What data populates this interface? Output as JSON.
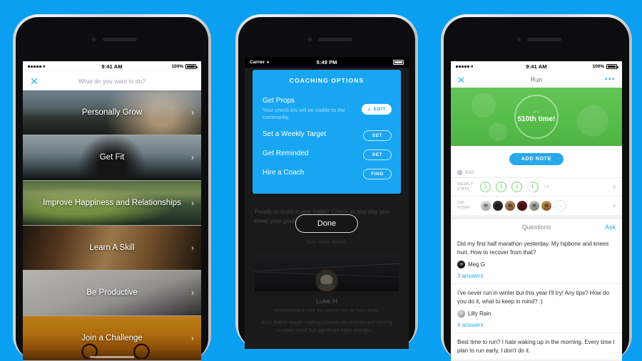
{
  "background_color": "#0a9ff0",
  "phone1": {
    "status_bar": {
      "signal": "•••••",
      "wifi_icon": "wifi-icon",
      "time": "9:41 AM",
      "battery_pct": "100%"
    },
    "search": {
      "close_icon": "✕",
      "placeholder": "What do you want to do?"
    },
    "categories": [
      {
        "label": "Personally Grow",
        "chevron": "›"
      },
      {
        "label": "Get Fit",
        "chevron": "›"
      },
      {
        "label": "Improve Happiness and Relationships",
        "chevron": "›"
      },
      {
        "label": "Learn A Skill",
        "chevron": "›"
      },
      {
        "label": "Be Productive",
        "chevron": "›"
      },
      {
        "label": "Join a Challenge",
        "chevron": "›"
      }
    ]
  },
  "phone2": {
    "status_bar": {
      "carrier": "Carrier",
      "wifi_icon": "wifi-icon",
      "time": "5:49 PM"
    },
    "modal": {
      "title": "COACHING OPTIONS",
      "accent_color": "#18a6f2",
      "options": [
        {
          "title": "Get Props",
          "subtitle": "Your check-ins will be visible to the community.",
          "action": "EDIT",
          "action_style": "filled",
          "check": "✓"
        },
        {
          "title": "Set a Weekly Target",
          "subtitle": "",
          "action": "SET",
          "action_style": "outline",
          "check": ""
        },
        {
          "title": "Get Reminded",
          "subtitle": "",
          "action": "SET",
          "action_style": "outline",
          "check": ""
        },
        {
          "title": "Hire a Coach",
          "subtitle": "",
          "action": "FIND",
          "action_style": "outline",
          "check": ""
        }
      ]
    },
    "done_label": "Done",
    "background": {
      "body_text": "Ready to build a new habit? Check in any day you meet your goal.",
      "link_text": "See more details",
      "coach_name": "Luke H",
      "coach_role": "RESPONSIBLE FOR 63 CHECK-INS IN THIS GOAL",
      "coach_desc": "Buzz British lawyer making positive life choices and striving to make small but significant habit changes…"
    }
  },
  "phone3": {
    "status_bar": {
      "signal": "•••••",
      "wifi_icon": "wifi-icon",
      "time": "9:41 AM",
      "battery_pct": "100%"
    },
    "nav": {
      "close_icon": "✕",
      "title": "Run",
      "more_icon": "•••"
    },
    "hero": {
      "sub_label": "It's",
      "main_label": "510th time!",
      "color": "#57bd4a"
    },
    "add_note_label": "ADD NOTE",
    "checkin_count": "5/10",
    "weekly_stats": {
      "caption": "WEEKLY STATS",
      "done": [
        "3",
        "3",
        "3"
      ],
      "current": "1",
      "target": "/ 3",
      "chevron": "›"
    },
    "today": {
      "caption": "239 TODAY",
      "avatar_count": 6,
      "add_icon": "⋯",
      "chevron": "›"
    },
    "questions_header": {
      "title": "Questions",
      "ask_label": "Ask"
    },
    "questions": [
      {
        "text": "Did my first half marathon yesterday. My hipbone and knees hurt. How to recover from that?",
        "author": "Meg G",
        "answers": "3 answers"
      },
      {
        "text": "I've never run in winter but this year I'll try! Any tips? How do you do it, what to keep in mind? :)",
        "author": "Lilly Rain",
        "answers": "4 answers"
      },
      {
        "text": "Best time to run? I hate waking up in the morning. Every time I plan to run early, I don't do it.",
        "author": "",
        "answers": ""
      }
    ]
  }
}
